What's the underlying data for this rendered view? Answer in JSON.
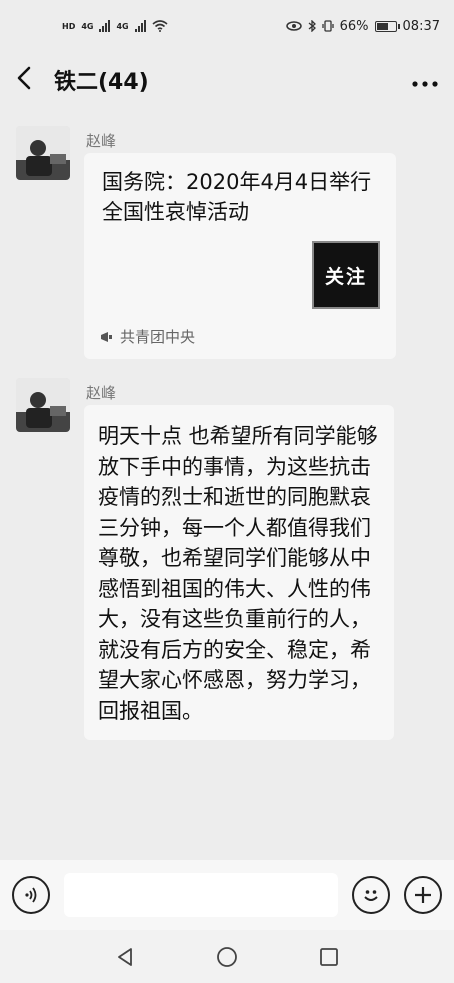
{
  "status_bar": {
    "left_badges": [
      "HD",
      "4G",
      "4G"
    ],
    "battery_text": "66%",
    "battery_level": 0.66,
    "time": "08:37"
  },
  "header": {
    "title": "铁二(44)"
  },
  "messages": [
    {
      "sender": "赵峰",
      "type": "card",
      "card_title": "国务院：2020年4月4日举行全国性哀悼活动",
      "card_button": "关注",
      "card_source": "共青团中央"
    },
    {
      "sender": "赵峰",
      "type": "text",
      "text": "明天十点 也希望所有同学能够放下手中的事情，为这些抗击疫情的烈士和逝世的同胞默哀三分钟，每一个人都值得我们尊敬，也希望同学们能够从中感悟到祖国的伟大、人性的伟大，没有这些负重前行的人，就没有后方的安全、稳定，希望大家心怀感恩，努力学习，回报祖国。"
    }
  ],
  "input_bar": {
    "placeholder": ""
  }
}
